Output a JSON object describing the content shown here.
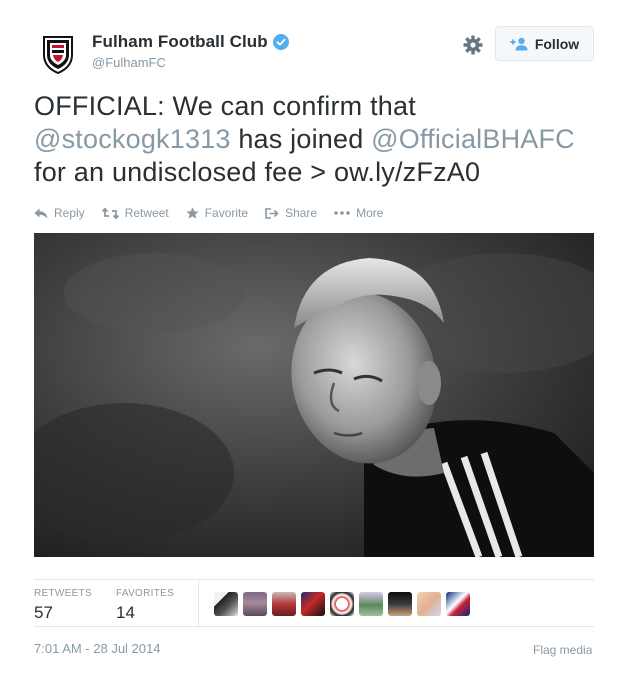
{
  "account": {
    "name": "Fulham Football Club",
    "handle": "@FulhamFC",
    "verified": true
  },
  "header": {
    "follow_label": "Follow",
    "settings_icon": "gear-icon",
    "follow_icon": "person-plus-icon"
  },
  "tweet": {
    "segments": {
      "prefix": "OFFICIAL: We can confirm that",
      "mention1": "@stockogk1313",
      "middle": " has joined ",
      "mention2": "@OfficialBHAFC",
      "suffix": "for an undisclosed fee > ",
      "link": "ow.ly/zFzA0"
    }
  },
  "actions": {
    "reply": "Reply",
    "retweet": "Retweet",
    "favorite": "Favorite",
    "share": "Share",
    "more": "More"
  },
  "stats": {
    "retweets_label": "RETWEETS",
    "retweets_value": "57",
    "favorites_label": "FAVORITES",
    "favorites_value": "14",
    "favoriter_count": 9
  },
  "footer": {
    "timestamp": "7:01 AM - 28 Jul 2014",
    "flag_media": "Flag media"
  },
  "colors": {
    "text": "#292f33",
    "muted": "#8899a6",
    "verified": "#55acee",
    "border": "#e1e8ed"
  }
}
